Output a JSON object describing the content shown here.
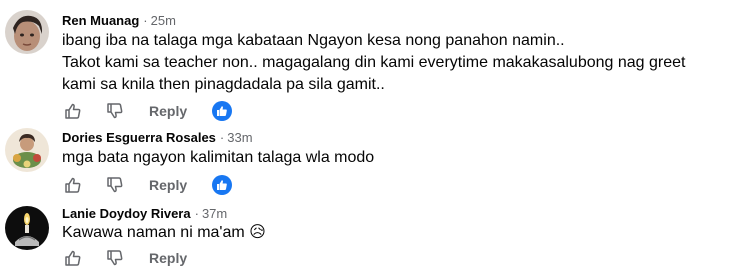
{
  "comments": [
    {
      "author": "Ren Muanag",
      "time": "25m",
      "lines": [
        "ibang iba na talaga mga kabataan Ngayon kesa nong panahon namin..",
        "Takot kami sa teacher non.. magagalang din kami everytime makakasalubong nag greet",
        "kami sa knila then pinagdadala pa sila gamit.."
      ],
      "reply_label": "Reply",
      "has_reaction": true
    },
    {
      "author": "Dories Esguerra Rosales",
      "time": "33m",
      "lines": [
        "mga bata ngayon kalimitan talaga wla modo"
      ],
      "reply_label": "Reply",
      "has_reaction": true
    },
    {
      "author": "Lanie Doydoy Rivera",
      "time": "37m",
      "lines": [
        "Kawawa naman ni ma'am 😥"
      ],
      "reply_label": "Reply",
      "has_reaction": false
    }
  ],
  "colors": {
    "meta_gray": "#65676b",
    "like_blue": "#1877f2",
    "text": "#050505"
  },
  "icons": {
    "like": "thumbs-up-icon",
    "dislike": "thumbs-down-icon",
    "reaction": "like-reaction-icon"
  }
}
